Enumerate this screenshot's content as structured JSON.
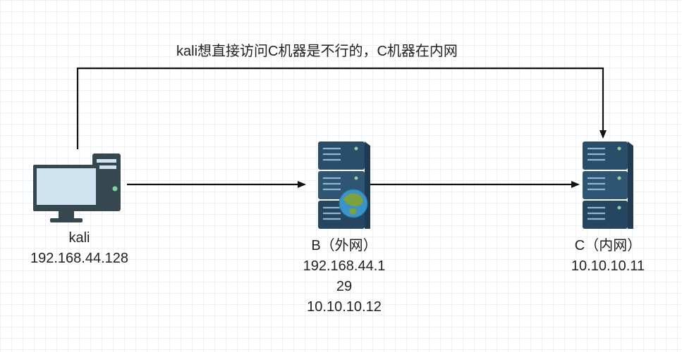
{
  "title": "kali想直接访问C机器是不行的，C机器在内网",
  "nodes": {
    "kali": {
      "label": "kali",
      "ip": "192.168.44.128"
    },
    "b": {
      "label": "B（外网）",
      "ip1": "192.168.44.1",
      "ip2": "29",
      "ip3": "10.10.10.12"
    },
    "c": {
      "label": "C（内网）",
      "ip": "10.10.10.11"
    }
  },
  "colors": {
    "server_body": "#2a4e69",
    "server_front": "#355f7d",
    "server_dark": "#203b51",
    "monitor_frame": "#37474f",
    "monitor_screen": "#cfe4f0",
    "globe_land": "#7ba23f",
    "globe_ocean": "#3a93c9",
    "arrow": "#111111"
  }
}
